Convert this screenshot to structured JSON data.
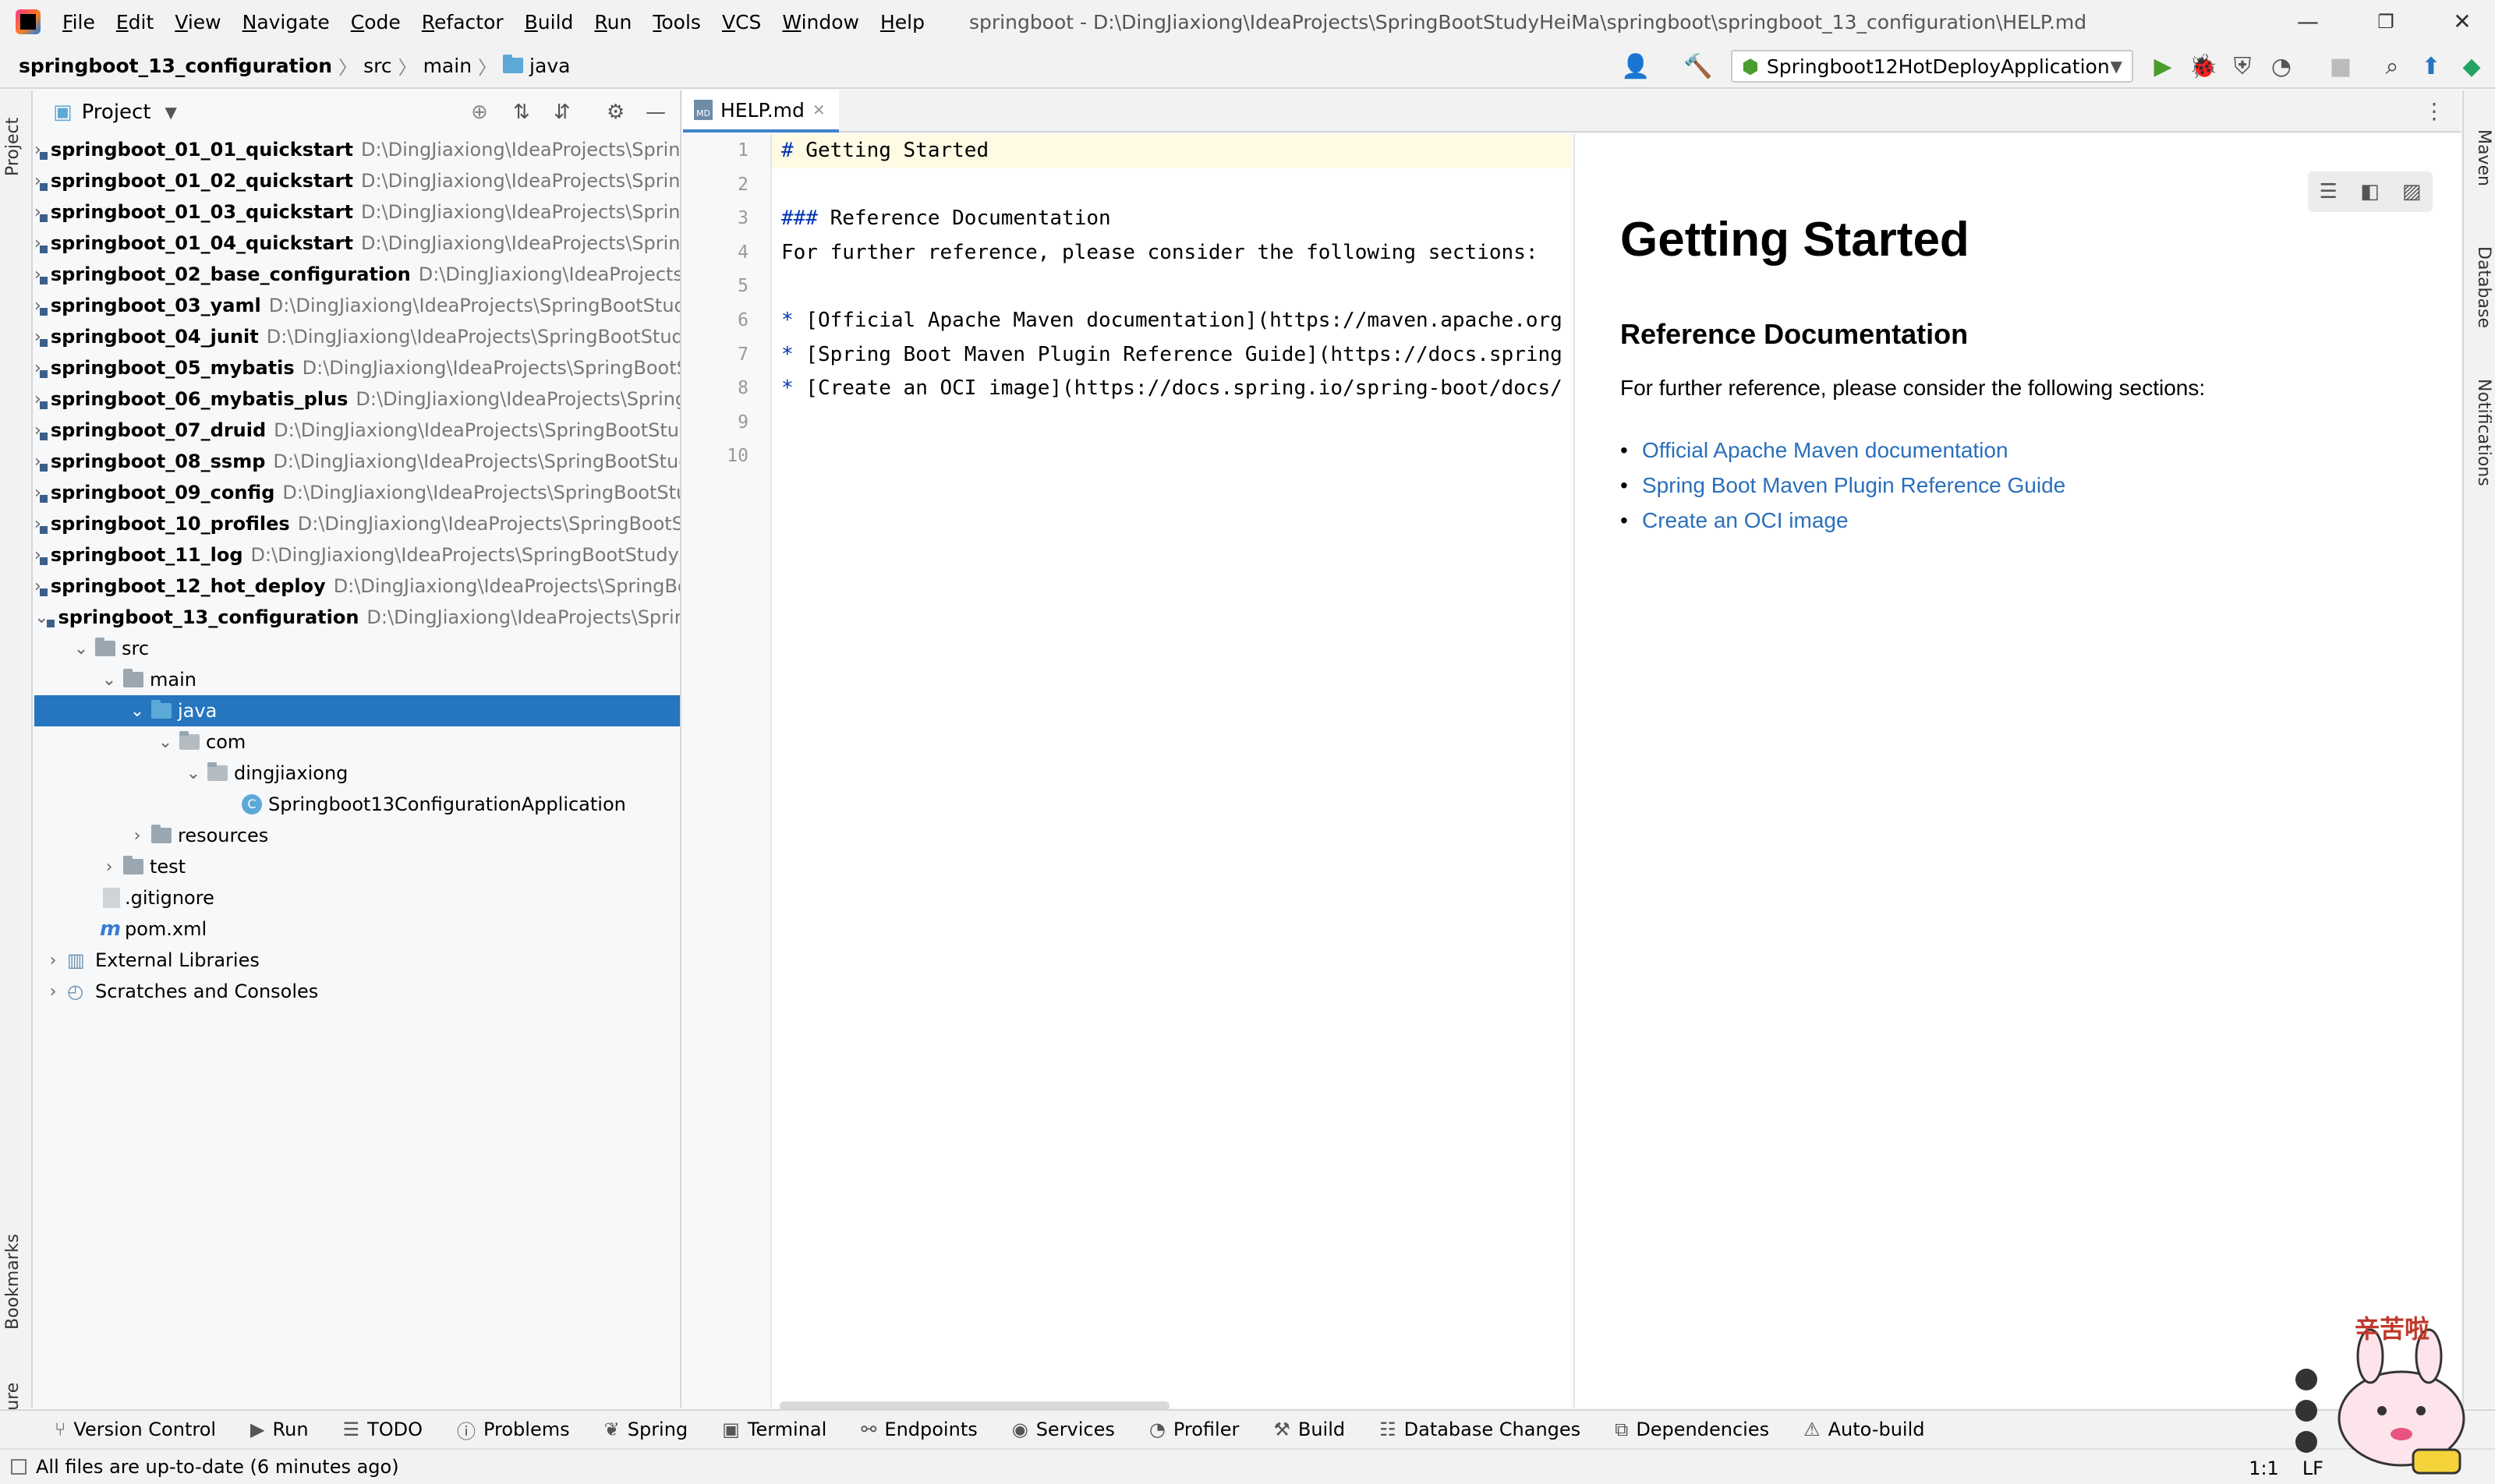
{
  "menubar": {
    "items": [
      "File",
      "Edit",
      "View",
      "Navigate",
      "Code",
      "Refactor",
      "Build",
      "Run",
      "Tools",
      "VCS",
      "Window",
      "Help"
    ],
    "title": "springboot - D:\\DingJiaxiong\\IdeaProjects\\SpringBootStudyHeiMa\\springboot\\springboot_13_configuration\\HELP.md"
  },
  "navbar": {
    "crumbs": [
      "springboot_13_configuration",
      "src",
      "main",
      "java"
    ],
    "run_config": "Springboot12HotDeployApplication"
  },
  "project": {
    "title": "Project",
    "rows": [
      {
        "name": "springboot_01_01_quickstart",
        "path": "D:\\DingJiaxiong\\IdeaProjects\\SpringBootStudyHeiMa"
      },
      {
        "name": "springboot_01_02_quickstart",
        "path": "D:\\DingJiaxiong\\IdeaProjects\\SpringBootStudyHeiMa"
      },
      {
        "name": "springboot_01_03_quickstart",
        "path": "D:\\DingJiaxiong\\IdeaProjects\\SpringBootStudyHeiMa"
      },
      {
        "name": "springboot_01_04_quickstart",
        "path": "D:\\DingJiaxiong\\IdeaProjects\\SpringBootStudyHeiMa"
      },
      {
        "name": "springboot_02_base_configuration",
        "path": "D:\\DingJiaxiong\\IdeaProjects\\SpringBootStudyHeiMa"
      },
      {
        "name": "springboot_03_yaml",
        "path": "D:\\DingJiaxiong\\IdeaProjects\\SpringBootStudyHeiMa"
      },
      {
        "name": "springboot_04_junit",
        "path": "D:\\DingJiaxiong\\IdeaProjects\\SpringBootStudyHeiMa"
      },
      {
        "name": "springboot_05_mybatis",
        "path": "D:\\DingJiaxiong\\IdeaProjects\\SpringBootStudyHeiMa"
      },
      {
        "name": "springboot_06_mybatis_plus",
        "path": "D:\\DingJiaxiong\\IdeaProjects\\SpringBootStudyHeiMa"
      },
      {
        "name": "springboot_07_druid",
        "path": "D:\\DingJiaxiong\\IdeaProjects\\SpringBootStudyHeiMa"
      },
      {
        "name": "springboot_08_ssmp",
        "path": "D:\\DingJiaxiong\\IdeaProjects\\SpringBootStudyHeiMa"
      },
      {
        "name": "springboot_09_config",
        "path": "D:\\DingJiaxiong\\IdeaProjects\\SpringBootStudyHeiMa"
      },
      {
        "name": "springboot_10_profiles",
        "path": "D:\\DingJiaxiong\\IdeaProjects\\SpringBootStudyHeiMa"
      },
      {
        "name": "springboot_11_log",
        "path": "D:\\DingJiaxiong\\IdeaProjects\\SpringBootStudyHeiMa"
      },
      {
        "name": "springboot_12_hot_deploy",
        "path": "D:\\DingJiaxiong\\IdeaProjects\\SpringBootStudyHeiMa"
      },
      {
        "name": "springboot_13_configuration",
        "path": "D:\\DingJiaxiong\\IdeaProjects\\SpringBootStudyHeiMa"
      }
    ],
    "tree": {
      "src": "src",
      "main": "main",
      "java": "java",
      "com": "com",
      "dingjiaxiong": "dingjiaxiong",
      "app": "Springboot13ConfigurationApplication",
      "resources": "resources",
      "test": "test",
      "gitignore": ".gitignore",
      "pom": "pom.xml",
      "ext": "External Libraries",
      "scratches": "Scratches and Consoles"
    }
  },
  "editor": {
    "tab": "HELP.md",
    "lines": [
      "# Getting Started",
      "",
      "### Reference Documentation",
      "For further reference, please consider the following sections:",
      "",
      "* [Official Apache Maven documentation](https://maven.apache.org",
      "* [Spring Boot Maven Plugin Reference Guide](https://docs.spring",
      "* [Create an OCI image](https://docs.spring.io/spring-boot/docs/",
      "",
      ""
    ],
    "line_numbers": [
      "1",
      "2",
      "3",
      "4",
      "5",
      "6",
      "7",
      "8",
      "9",
      "10"
    ]
  },
  "preview": {
    "h1": "Getting Started",
    "h3": "Reference Documentation",
    "para": "For further reference, please consider the following sections:",
    "links": [
      "Official Apache Maven documentation",
      "Spring Boot Maven Plugin Reference Guide",
      "Create an OCI image"
    ]
  },
  "left_stripe": {
    "project": "Project",
    "bookmarks": "Bookmarks",
    "structure": "Structure"
  },
  "right_stripe": {
    "maven": "Maven",
    "database": "Database",
    "notifications": "Notifications"
  },
  "toolwindows": [
    "Version Control",
    "Run",
    "TODO",
    "Problems",
    "Spring",
    "Terminal",
    "Endpoints",
    "Services",
    "Profiler",
    "Build",
    "Database Changes",
    "Dependencies",
    "Auto-build"
  ],
  "status": {
    "message": "All files are up-to-date (6 minutes ago)",
    "position": "1:1",
    "line_sep": "LF"
  },
  "mascot": {
    "text": "辛苦啦"
  },
  "colors": {
    "selection": "#2675bf",
    "link": "#2a6fbb",
    "markdown_marker": "#0033b3"
  }
}
